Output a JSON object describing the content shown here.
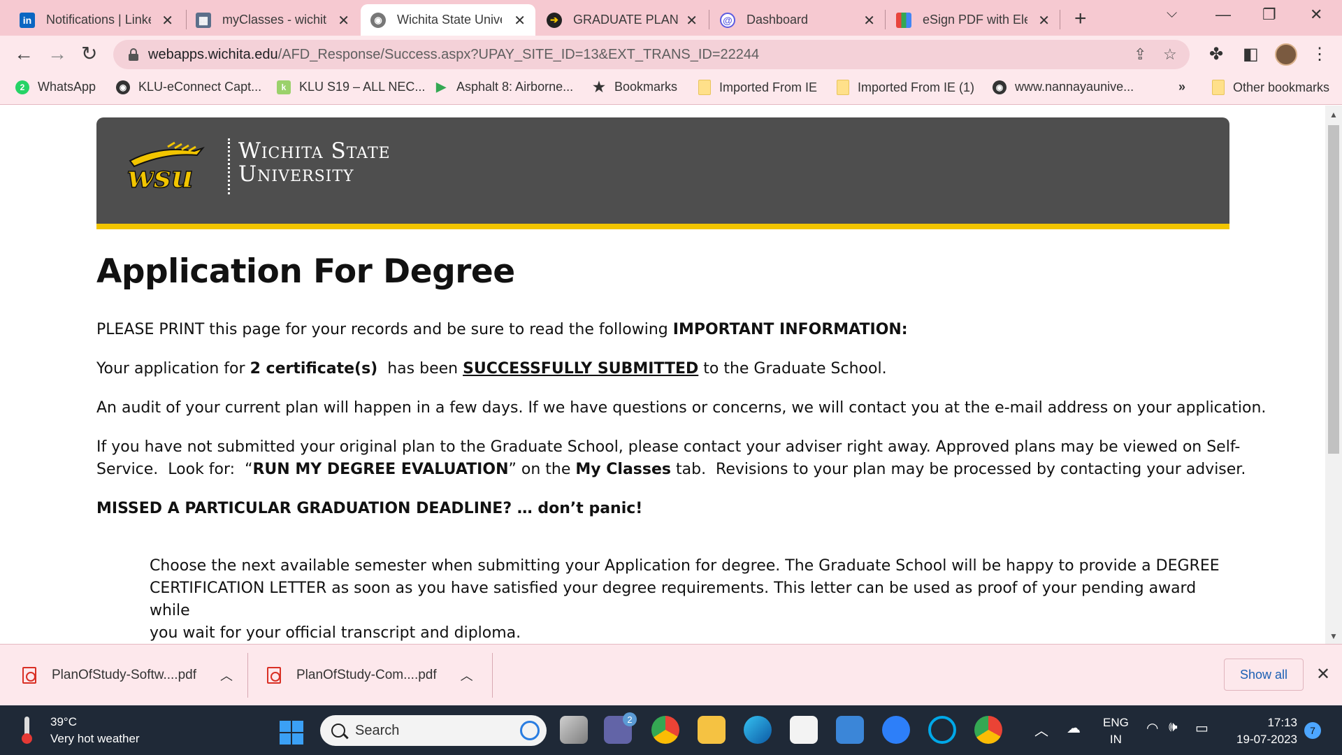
{
  "browser": {
    "tabs": [
      {
        "title": "Notifications | LinkedIn",
        "icon": "linkedin-icon",
        "color": "#0a66c2",
        "glyph": "in"
      },
      {
        "title": "myClasses - wichita",
        "icon": "myclasses-icon",
        "color": "#5b6f8a",
        "glyph": "▦"
      },
      {
        "title": "Wichita State University",
        "icon": "globe-icon",
        "color": "#777777",
        "glyph": "◉",
        "active": true
      },
      {
        "title": "GRADUATE PLAN OF STUDY",
        "icon": "arrow-circle-icon",
        "color": "#222222",
        "glyph": "➔"
      },
      {
        "title": "Dashboard",
        "icon": "dashboard-icon",
        "color": "#5b5be0",
        "glyph": "@"
      },
      {
        "title": "eSign PDF with Electronic",
        "icon": "esign-icon",
        "color": "#e8453c",
        "glyph": "▚"
      }
    ],
    "url_host": "webapps.wichita.edu",
    "url_path": "/AFD_Response/Success.aspx?UPAY_SITE_ID=13&EXT_TRANS_ID=22244",
    "bookmarks": [
      {
        "label": "WhatsApp",
        "icon": "whatsapp-icon",
        "color": "#25d366",
        "glyph": "2"
      },
      {
        "label": "KLU-eConnect Capt...",
        "icon": "globe-icon",
        "color": "#333333",
        "glyph": "◉"
      },
      {
        "label": "KLU S19 – ALL NEC...",
        "icon": "klu-icon",
        "color": "#9bd16b",
        "glyph": "k"
      },
      {
        "label": "Asphalt 8: Airborne...",
        "icon": "play-store-icon",
        "color": "#34a853",
        "glyph": "▶"
      },
      {
        "label": "Bookmarks",
        "icon": "star-icon",
        "color": "#333333",
        "glyph": "★"
      },
      {
        "label": "Imported From IE",
        "icon": "folder-icon",
        "folder": true
      },
      {
        "label": "Imported From IE (1)",
        "icon": "folder-icon",
        "folder": true
      },
      {
        "label": "www.nannayaunive...",
        "icon": "globe-icon",
        "color": "#333333",
        "glyph": "◉"
      }
    ],
    "bookmarks_overflow": "»",
    "other_bookmarks": "Other bookmarks"
  },
  "page": {
    "logo_line1": "Wichita State",
    "logo_line2": "University",
    "logo_mark": "wsu",
    "title": "Application For Degree",
    "p1_text": "PLEASE PRINT this page for your records and be sure to read the following ",
    "p1_bold": "IMPORTANT INFORMATION:",
    "p2_a": "Your application for ",
    "p2_bold": "2 certificate(s)",
    "p2_b": "  has been ",
    "p2_underline": "SUCCESSFULLY SUBMITTED",
    "p2_c": " to the Graduate School.",
    "p3": "An audit of your current plan will happen in a few days.  If we have questions or concerns, we will contact you at the e-mail address on your application.",
    "p4_line1": "If you have not submitted your original plan to the Graduate School, please contact your adviser right away.  Approved plans may be viewed on Self-",
    "p4_line2_a": "Service.  Look for:  “",
    "p4_line2_bold1": "RUN MY DEGREE EVALUATION",
    "p4_line2_b": "” on the ",
    "p4_line2_bold2": "My Classes",
    "p4_line2_c": " tab.  Revisions to your plan may be processed by contacting your adviser.",
    "missed": "MISSED A PARTICULAR GRADUATION DEADLINE? … don’t panic!",
    "indent_line1": "Choose the next available semester when submitting your Application for degree.  The Graduate School will be happy to provide a DEGREE",
    "indent_line2": "CERTIFICATION LETTER as soon as you have satisfied your degree requirements.  This letter can be used as proof of your pending award while",
    "indent_line3": "you wait for your official transcript and diploma."
  },
  "downloads": {
    "items": [
      "PlanOfStudy-Softw....pdf",
      "PlanOfStudy-Com....pdf"
    ],
    "show_all": "Show all"
  },
  "taskbar": {
    "temperature": "39°C",
    "weather": "Very hot weather",
    "search_placeholder": "Search",
    "chat_badge": "2",
    "lang_top": "ENG",
    "lang_bottom": "IN",
    "time": "17:13",
    "date": "19-07-2023",
    "notifications": "7"
  },
  "colors": {
    "banner": "#4e4e4e",
    "gold": "#f2c500",
    "tabstrip": "#f6c9d1",
    "toolbar": "#fde8ec"
  }
}
